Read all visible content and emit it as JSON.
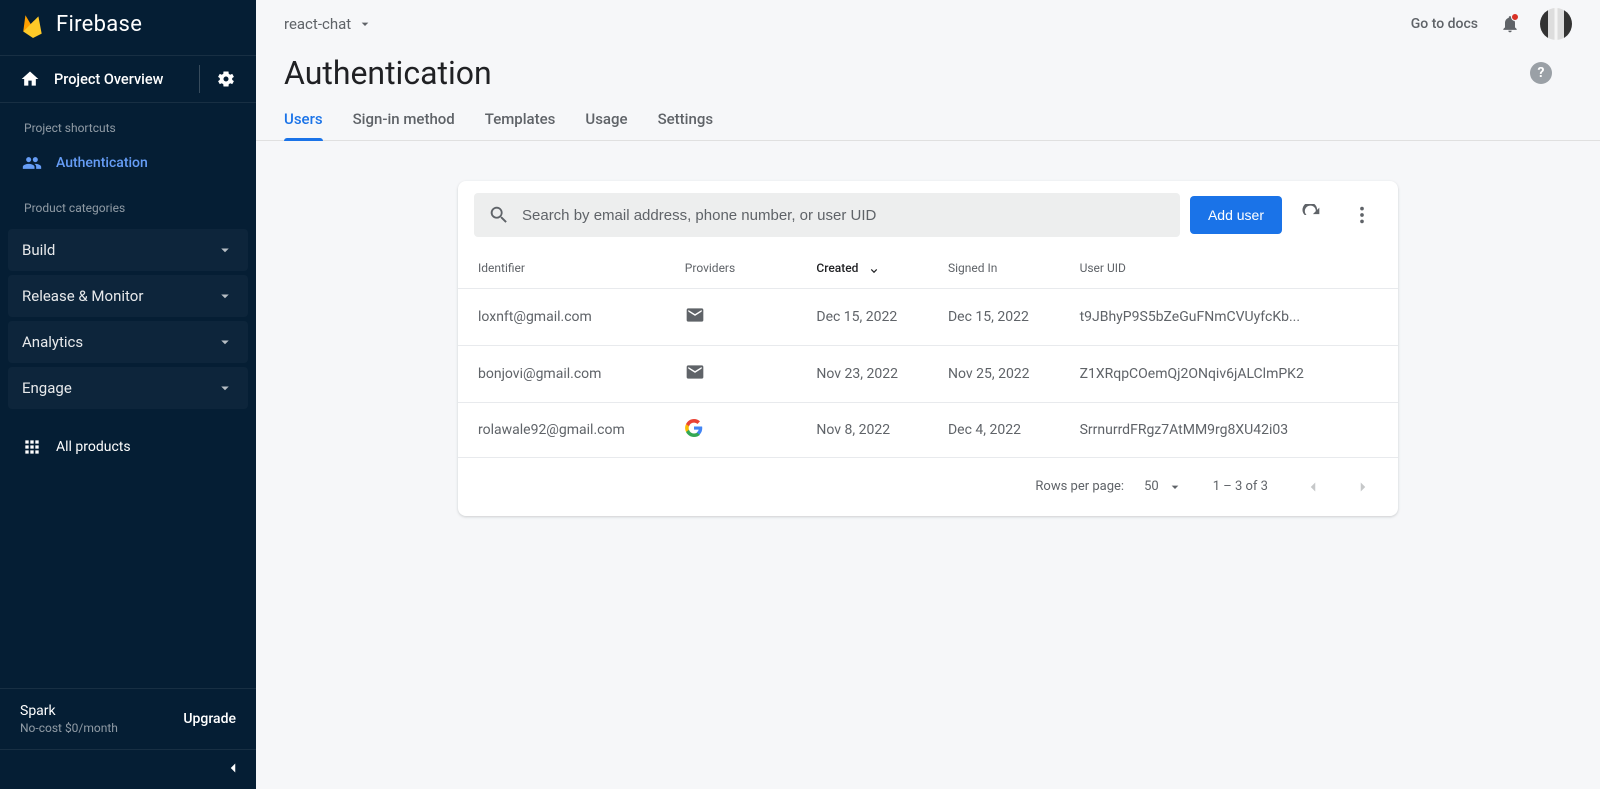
{
  "brand": "Firebase",
  "overview_label": "Project Overview",
  "shortcuts_label": "Project shortcuts",
  "shortcut_auth": "Authentication",
  "categories_label": "Product categories",
  "categories": [
    {
      "label": "Build"
    },
    {
      "label": "Release & Monitor"
    },
    {
      "label": "Analytics"
    },
    {
      "label": "Engage"
    }
  ],
  "all_products": "All products",
  "spark": {
    "name": "Spark",
    "sub": "No-cost $0/month",
    "upgrade": "Upgrade"
  },
  "topbar": {
    "project": "react-chat",
    "docs": "Go to docs"
  },
  "page_title": "Authentication",
  "tabs": [
    {
      "label": "Users",
      "active": true
    },
    {
      "label": "Sign-in method"
    },
    {
      "label": "Templates"
    },
    {
      "label": "Usage"
    },
    {
      "label": "Settings"
    }
  ],
  "search": {
    "placeholder": "Search by email address, phone number, or user UID"
  },
  "add_user_label": "Add user",
  "columns": {
    "identifier": "Identifier",
    "providers": "Providers",
    "created": "Created",
    "signed_in": "Signed In",
    "uid": "User UID"
  },
  "users": [
    {
      "identifier": "loxnft@gmail.com",
      "provider": "email",
      "created": "Dec 15, 2022",
      "signed_in": "Dec 15, 2022",
      "uid": "t9JBhyP9S5bZeGuFNmCVUyfcKb..."
    },
    {
      "identifier": "bonjovi@gmail.com",
      "provider": "email",
      "created": "Nov 23, 2022",
      "signed_in": "Nov 25, 2022",
      "uid": "Z1XRqpCOemQj2ONqiv6jALClmPK2"
    },
    {
      "identifier": "rolawale92@gmail.com",
      "provider": "google",
      "created": "Nov 8, 2022",
      "signed_in": "Dec 4, 2022",
      "uid": "SrrnurrdFRgz7AtMM9rg8XU42i03"
    }
  ],
  "footer": {
    "rpp_label": "Rows per page:",
    "rpp_value": "50",
    "range": "1 – 3 of 3"
  }
}
